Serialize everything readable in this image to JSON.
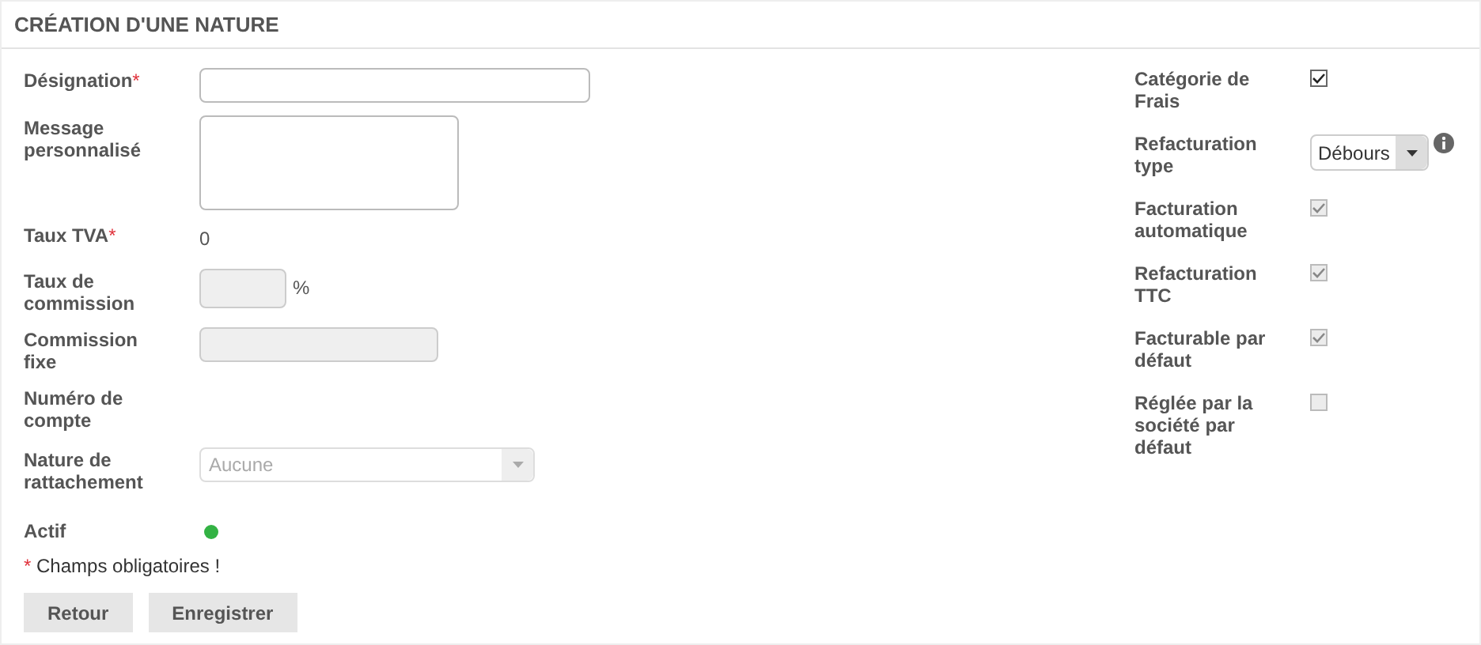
{
  "title": "CRÉATION D'UNE NATURE",
  "left_fields": [
    {
      "label": "Désignation",
      "required": true,
      "kind": "input",
      "disabled": false
    },
    {
      "label": "Message personnalisé",
      "required": false,
      "kind": "textarea",
      "disabled": false
    },
    {
      "label": "Taux TVA",
      "required": true,
      "kind": "text",
      "value": "0"
    },
    {
      "label": "Taux de commission",
      "required": false,
      "kind": "input-suffix",
      "disabled": true,
      "suffix": "%"
    },
    {
      "label": "Commission fixe",
      "required": false,
      "kind": "input",
      "disabled": true
    },
    {
      "label": "Numéro de compte",
      "required": false,
      "kind": "empty"
    },
    {
      "label": "Nature de rattachement",
      "required": false,
      "kind": "select",
      "disabled": true,
      "value": "Aucune"
    },
    {
      "label": "Actif",
      "required": false,
      "kind": "dot",
      "on": true
    }
  ],
  "right_fields": [
    {
      "label": "Catégorie de Frais",
      "kind": "checkbox",
      "checked": true,
      "disabled": false
    },
    {
      "label": "Refacturation type",
      "kind": "select",
      "value": "Débours"
    },
    {
      "label": "Facturation automatique",
      "kind": "checkbox",
      "checked": true,
      "disabled": true
    },
    {
      "label": "Refacturation TTC",
      "kind": "checkbox",
      "checked": true,
      "disabled": true
    },
    {
      "label": "Facturable par défaut",
      "kind": "checkbox",
      "checked": true,
      "disabled": true
    },
    {
      "label": "Réglée par la société par défaut",
      "kind": "checkbox",
      "checked": false,
      "disabled": true
    }
  ],
  "required_mark": "*",
  "required_note": "Champs obligatoires !",
  "buttons": [
    "Retour",
    "Enregistrer"
  ]
}
